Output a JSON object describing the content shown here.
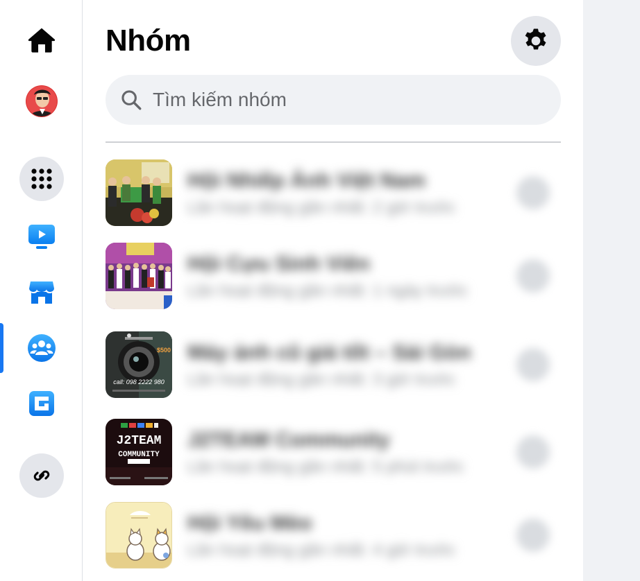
{
  "page": {
    "title": "Nhóm",
    "search_placeholder": "Tìm kiếm nhóm"
  },
  "rail": {
    "items": [
      {
        "name": "home",
        "icon": "home-icon"
      },
      {
        "name": "profile",
        "icon": "avatar"
      },
      {
        "name": "menu",
        "icon": "grid-menu-icon"
      },
      {
        "name": "watch",
        "icon": "video-play-icon"
      },
      {
        "name": "marketplace",
        "icon": "store-icon"
      },
      {
        "name": "groups",
        "icon": "people-group-icon",
        "active": true
      },
      {
        "name": "gaming",
        "icon": "gaming-icon"
      },
      {
        "name": "link",
        "icon": "link-icon"
      }
    ]
  },
  "groups": [
    {
      "name": "Hội Nhiếp Ảnh Việt Nam",
      "meta": "Lần hoạt động gần nhất: 2 giờ trước",
      "thumb_text": ""
    },
    {
      "name": "Hội Cựu Sinh Viên",
      "meta": "Lần hoạt động gần nhất: 1 ngày trước",
      "thumb_text": ""
    },
    {
      "name": "Máy ảnh cũ giá tốt – Sài Gòn",
      "meta": "Lần hoạt động gần nhất: 3 giờ trước",
      "thumb_text": "call: 098 2222 980"
    },
    {
      "name": "J2TEAM Community",
      "meta": "Lần hoạt động gần nhất: 5 phút trước",
      "thumb_text": "J2TEAM COMMUNITY"
    },
    {
      "name": "Hội Yêu Mèo",
      "meta": "Lần hoạt động gần nhất: 4 giờ trước",
      "thumb_text": ""
    }
  ],
  "colors": {
    "accent": "#1877f2",
    "rail_circle": "#e4e6eb",
    "search_bg": "#f0f2f5"
  }
}
